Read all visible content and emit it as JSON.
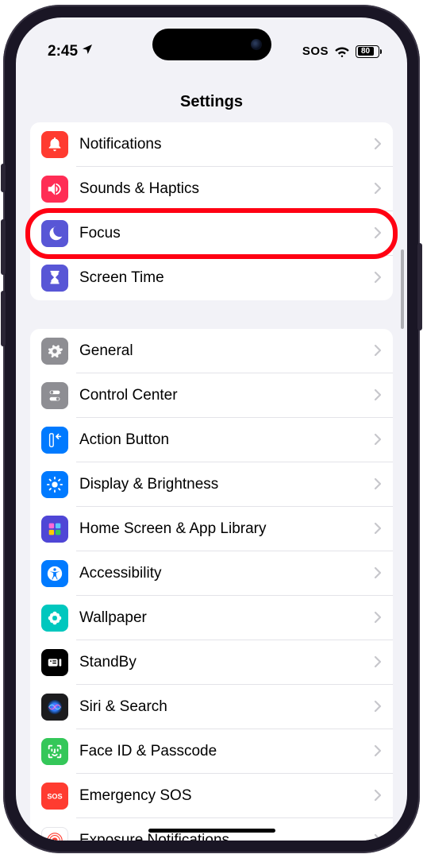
{
  "status": {
    "time": "2:45",
    "sos": "SOS",
    "battery": "80"
  },
  "header": {
    "title": "Settings"
  },
  "groups": [
    {
      "rows": [
        {
          "id": "notifications",
          "label": "Notifications",
          "icon": "bell",
          "color": "#ff3b30"
        },
        {
          "id": "sounds",
          "label": "Sounds & Haptics",
          "icon": "speaker",
          "color": "#ff2d55"
        },
        {
          "id": "focus",
          "label": "Focus",
          "icon": "moon",
          "color": "#5856d6",
          "highlighted": true
        },
        {
          "id": "screentime",
          "label": "Screen Time",
          "icon": "hourglass",
          "color": "#5856d6"
        }
      ]
    },
    {
      "rows": [
        {
          "id": "general",
          "label": "General",
          "icon": "gear",
          "color": "#8e8e93"
        },
        {
          "id": "controlcenter",
          "label": "Control Center",
          "icon": "switches",
          "color": "#8e8e93"
        },
        {
          "id": "actionbutton",
          "label": "Action Button",
          "icon": "actionbtn",
          "color": "#007aff"
        },
        {
          "id": "display",
          "label": "Display & Brightness",
          "icon": "sun",
          "color": "#007aff"
        },
        {
          "id": "homescreen",
          "label": "Home Screen & App Library",
          "icon": "apps",
          "color": "#4f46d6"
        },
        {
          "id": "accessibility",
          "label": "Accessibility",
          "icon": "accessibility",
          "color": "#007aff"
        },
        {
          "id": "wallpaper",
          "label": "Wallpaper",
          "icon": "flower",
          "color": "#00c7be"
        },
        {
          "id": "standby",
          "label": "StandBy",
          "icon": "standby",
          "color": "#000000"
        },
        {
          "id": "siri",
          "label": "Siri & Search",
          "icon": "siri",
          "color": "#1c1c1e"
        },
        {
          "id": "faceid",
          "label": "Face ID & Passcode",
          "icon": "faceid",
          "color": "#34c759"
        },
        {
          "id": "sos",
          "label": "Emergency SOS",
          "icon": "sostext",
          "color": "#ff3b30"
        },
        {
          "id": "exposure",
          "label": "Exposure Notifications",
          "icon": "exposure",
          "color": "#ffffff"
        }
      ]
    }
  ]
}
